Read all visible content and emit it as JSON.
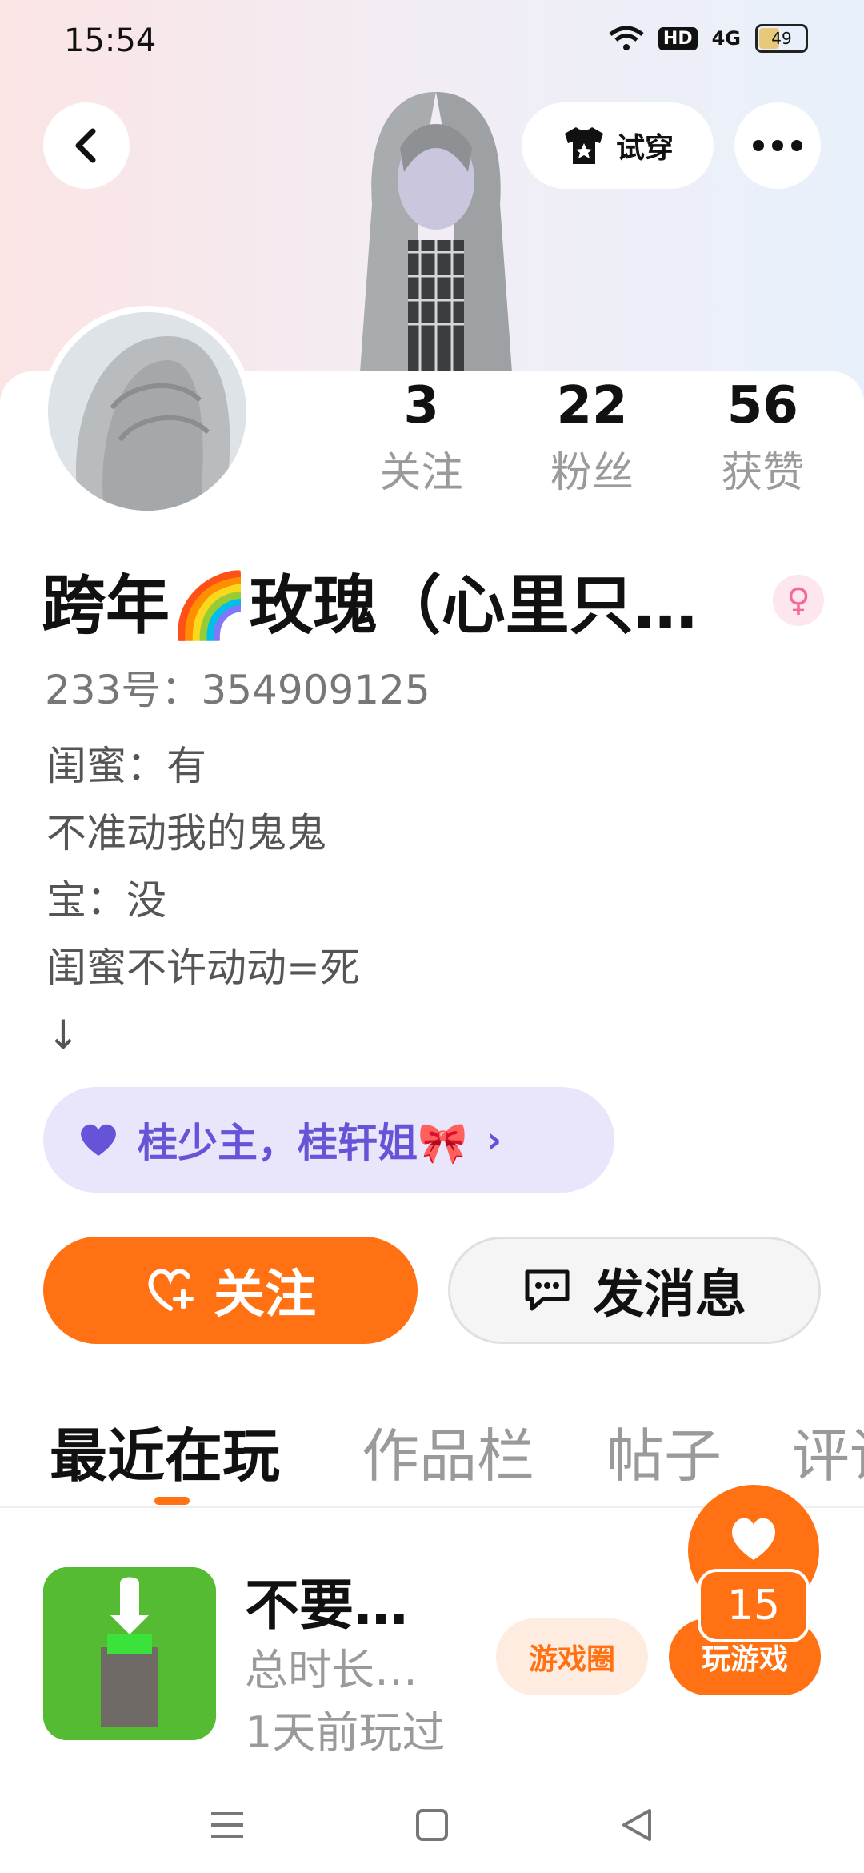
{
  "status_bar": {
    "time": "15:54",
    "network_badge": "HD",
    "signal": "4G",
    "battery": "49",
    "battery_level": 0.49
  },
  "header": {
    "try_on_label": "试穿",
    "icons": [
      "back-icon",
      "shirt-icon",
      "more-icon"
    ]
  },
  "profile": {
    "stats": [
      {
        "value": "3",
        "label": "关注"
      },
      {
        "value": "22",
        "label": "粉丝"
      },
      {
        "value": "56",
        "label": "获赞"
      }
    ],
    "name": "跨年🌈玫瑰（心里只…",
    "gender_symbol": "♀",
    "id_line": "233号：354909125",
    "bio_lines": [
      "闺蜜：有",
      "不准动我的鬼鬼",
      "宝：没",
      "闺蜜不许动动=死",
      "↓"
    ],
    "tag_text": "桂少主，桂轩姐🎀",
    "tag_arrow": "›"
  },
  "actions": {
    "follow_label": "关注",
    "message_label": "发消息"
  },
  "tabs": [
    {
      "label": "最近在玩",
      "active": true
    },
    {
      "label": "作品栏",
      "active": false
    },
    {
      "label": "帖子",
      "active": false
    },
    {
      "label": "评论",
      "active": false
    }
  ],
  "recent_game": {
    "title": "不要…",
    "duration": "总时长…",
    "last_played": "1天前玩过",
    "circle_button": "游戏圈",
    "play_button": "玩游戏"
  },
  "floating_like": {
    "count": "15"
  },
  "colors": {
    "accent": "#ff7113",
    "tag_bg": "#e9e6fb",
    "tag_text": "#6553d8",
    "gender": "#f2699b"
  }
}
